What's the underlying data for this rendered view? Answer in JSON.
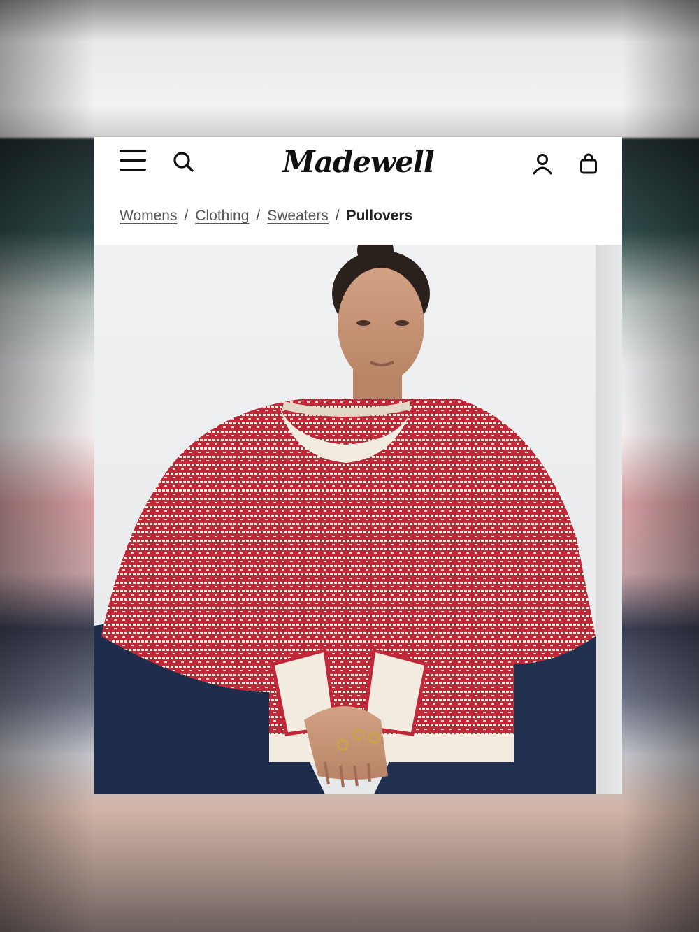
{
  "header": {
    "logo_text": "Madewell",
    "icons": [
      "menu-icon",
      "search-icon",
      "account-icon",
      "shopping-bag-icon"
    ]
  },
  "breadcrumb": {
    "items": [
      "Womens",
      "Clothing",
      "Sweaters"
    ],
    "separator": "/",
    "current": "Pullovers"
  },
  "product": {
    "sweater_colors": {
      "primary": "#c0283a",
      "secondary": "#f2ece0"
    },
    "denim_color": "#1f2d4d"
  }
}
